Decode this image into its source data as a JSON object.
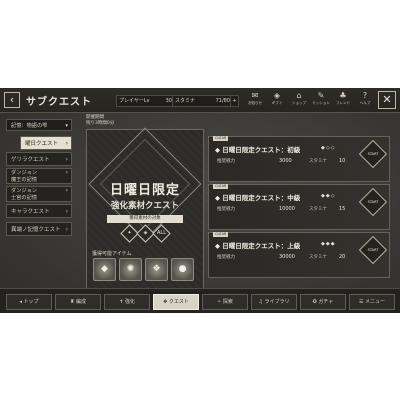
{
  "header": {
    "back_icon": "chevron-left",
    "title": "サブクエスト",
    "player_label": "プレイヤーLv",
    "player_level": "30",
    "stamina_label": "スタミナ",
    "stamina_value": "71/80",
    "add_icon": "plus",
    "icons": [
      {
        "glyph": "✉",
        "label": "お知らせ",
        "name": "notice-icon"
      },
      {
        "glyph": "◈",
        "label": "ギフト",
        "name": "gift-icon"
      },
      {
        "glyph": "⌂",
        "label": "ショップ",
        "name": "shop-icon"
      },
      {
        "glyph": "✎",
        "label": "ミッション",
        "name": "mission-icon"
      },
      {
        "glyph": "♣",
        "label": "フレンド",
        "name": "friend-icon"
      },
      {
        "glyph": "?",
        "label": "ヘルプ",
        "name": "help-icon"
      }
    ],
    "close_icon": "x"
  },
  "sidebar": {
    "category": "記憶：物語の雫",
    "items": [
      {
        "label": "曜日クエスト",
        "active": true
      },
      {
        "label": "ゲリラクエスト",
        "active": false
      },
      {
        "label": "ダンジョン\n魔王の記憶",
        "active": false
      },
      {
        "label": "ダンジョン\n士官の記憶",
        "active": false
      },
      {
        "label": "キャラクエスト",
        "active": false
      },
      {
        "label": "異端ノ記憶クエスト",
        "active": false
      }
    ]
  },
  "banner": {
    "label_line1": "開催期間",
    "label_line2": "残り3時間0分",
    "title": "日曜日限定",
    "subtitle": "強化素材クエスト",
    "target_label": "獲得素材の対象",
    "elements": [
      "✦",
      "◈",
      "ALL"
    ],
    "drops_label": "獲得可能アイテム",
    "drops": [
      "◆",
      "✺",
      "❖",
      "●"
    ]
  },
  "quests": [
    {
      "tag": "CLEAR",
      "title": "日曜日限定クエスト：初級",
      "diamonds": "◆◇◇",
      "rec_label": "推奨戦力",
      "rec_value": "3000",
      "stamina_label": "スタミナ",
      "stamina_value": "10",
      "go_label": "START"
    },
    {
      "tag": "CLEAR",
      "title": "日曜日限定クエスト：中級",
      "diamonds": "◆◆◇",
      "rec_label": "推奨戦力",
      "rec_value": "10000",
      "stamina_label": "スタミナ",
      "stamina_value": "15",
      "go_label": "START"
    },
    {
      "tag": "CLEAR",
      "title": "日曜日限定クエスト：上級",
      "diamonds": "◆◆◆",
      "rec_label": "推奨戦力",
      "rec_value": "30000",
      "stamina_label": "スタミナ",
      "stamina_value": "20",
      "go_label": "START"
    }
  ],
  "bottom_nav": [
    {
      "label": "◂ トップ",
      "active": false
    },
    {
      "label": "♜ 編成",
      "active": false
    },
    {
      "label": "✝ 強化",
      "active": false
    },
    {
      "label": "✥ クエスト",
      "active": true
    },
    {
      "label": "✧ 探索",
      "active": false
    },
    {
      "label": "♫ ライブラリ",
      "active": false
    },
    {
      "label": "✪ ガチャ",
      "active": false
    },
    {
      "label": "☰ メニュー",
      "active": false
    }
  ],
  "colors": {
    "background": "#3a3936",
    "accent_light": "#e5e0d1",
    "text": "#e9e5d8"
  }
}
